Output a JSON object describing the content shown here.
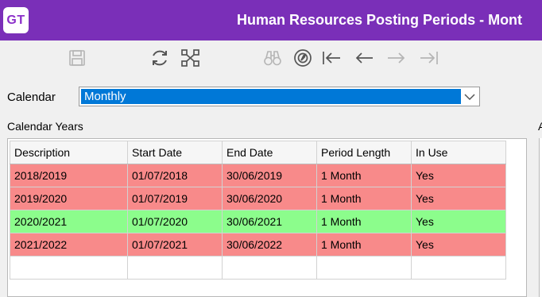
{
  "window": {
    "logo": "GT",
    "title": "Human Resources Posting Periods - Mont"
  },
  "toolbar": {
    "icons": [
      "save-icon",
      "refresh-icon",
      "network-icon",
      "binoculars-icon",
      "compass-icon",
      "first-record-icon",
      "previous-record-icon",
      "next-record-icon",
      "last-record-icon"
    ]
  },
  "calendar": {
    "label": "Calendar",
    "selected": "Monthly"
  },
  "calendar_years": {
    "label": "Calendar Years",
    "columns": [
      "Description",
      "Start Date",
      "End Date",
      "Period Length",
      "In Use"
    ],
    "rows": [
      {
        "description": "2018/2019",
        "start": "01/07/2018",
        "end": "30/06/2019",
        "period": "1 Month",
        "in_use": "Yes",
        "status": "notinuse"
      },
      {
        "description": "2019/2020",
        "start": "01/07/2019",
        "end": "30/06/2020",
        "period": "1 Month",
        "in_use": "Yes",
        "status": "notinuse"
      },
      {
        "description": "2020/2021",
        "start": "01/07/2020",
        "end": "30/06/2021",
        "period": "1 Month",
        "in_use": "Yes",
        "status": "inuse"
      },
      {
        "description": "2021/2022",
        "start": "01/07/2021",
        "end": "30/06/2022",
        "period": "1 Month",
        "in_use": "Yes",
        "status": "notinuse"
      }
    ]
  },
  "right_panel": {
    "label_fragment": "A"
  },
  "colors": {
    "title_bar": "#7a2fb8",
    "row_red": "#f88a8a",
    "row_green": "#8cfd8c",
    "selection": "#0078d7"
  }
}
